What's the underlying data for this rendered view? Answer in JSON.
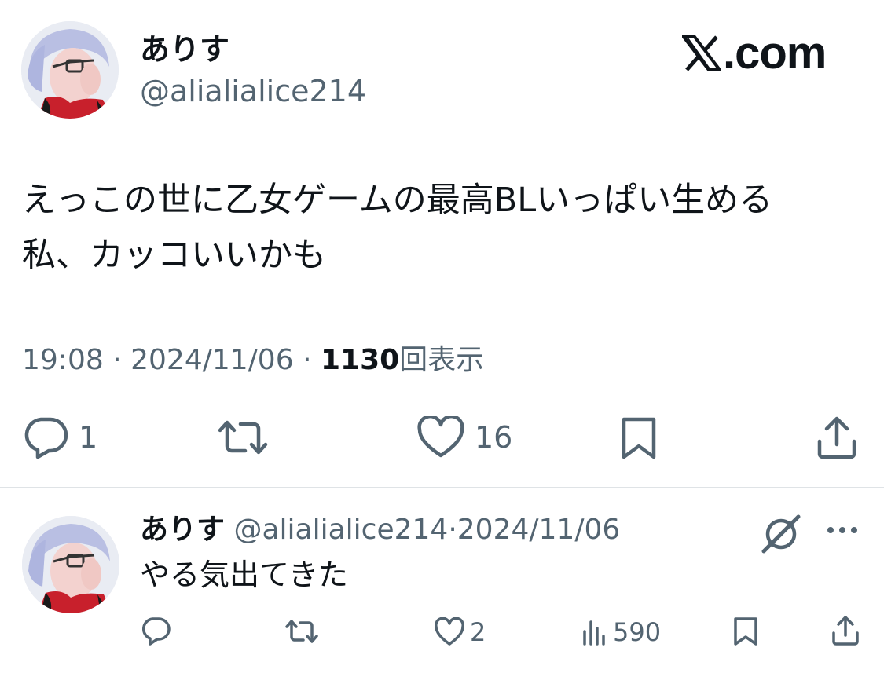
{
  "main_tweet": {
    "author_name": "ありす",
    "author_handle": "@alialialice214",
    "text": "えっこの世に乙女ゲームの最高BLいっぱい生める\n私、カッコいいかも",
    "time": "19:08",
    "date": "2024/11/06",
    "separator": "·",
    "views_count": "1130",
    "views_label": "回表示",
    "reply_count": "1",
    "like_count": "16"
  },
  "brand": {
    "logo_icon": "x-logo-icon",
    "logo_text": ".com"
  },
  "reply_tweet": {
    "author_name": "ありす",
    "author_handle": "@alialialice214",
    "separator": "·",
    "date": "2024/11/06",
    "text": "やる気出てきた",
    "like_count": "2",
    "views_count": "590"
  },
  "colors": {
    "text_primary": "#0f1419",
    "text_secondary": "#536471",
    "divider": "#dfe3e6",
    "background": "#ffffff"
  }
}
